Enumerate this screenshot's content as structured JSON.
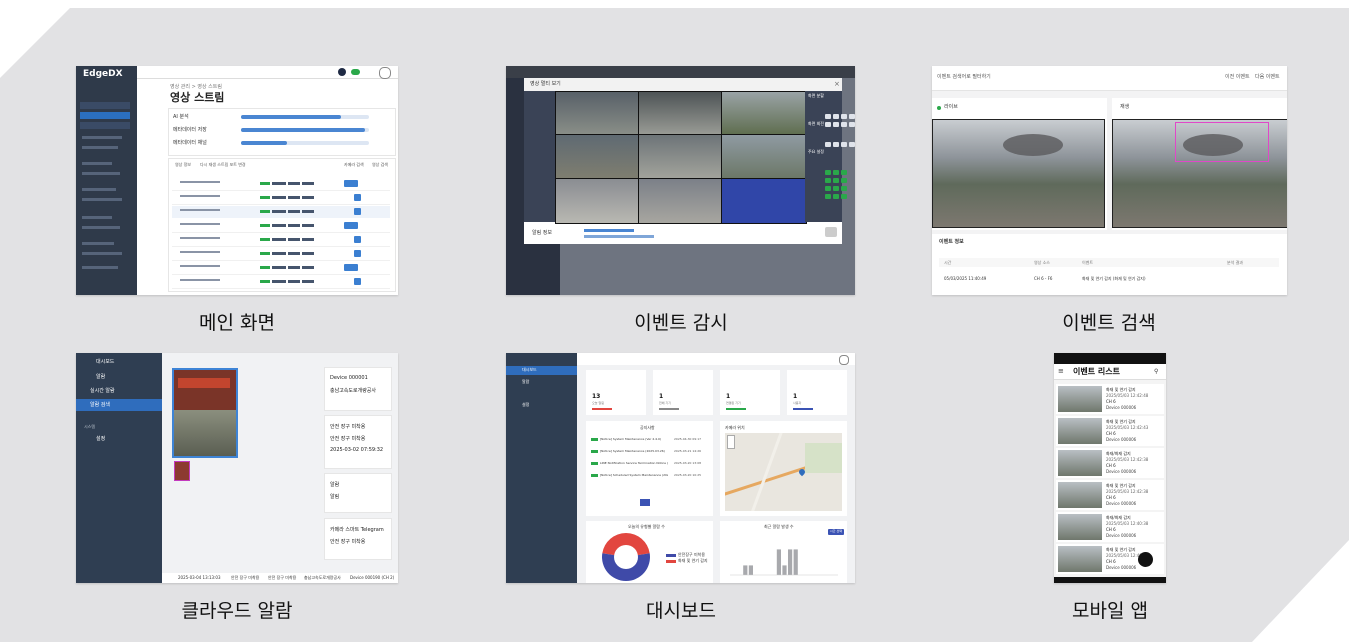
{
  "captions": [
    "메인 화면",
    "이벤트 감시",
    "이벤트 검색",
    "클라우드 알람",
    "대시보드",
    "모바일 앱"
  ],
  "main": {
    "logo": "EdgeDX",
    "title": "영상 스트림",
    "breadcrumb": "영상 관리 > 영상 스트림",
    "stats": [
      "AI 분석",
      "메타데이터 저장",
      "메타데이터 채널"
    ],
    "buttons": [
      "영상 정보",
      "다시 재생 스트림 포트 변경",
      "카메라 검색",
      "영상 검색"
    ]
  },
  "monitor": {
    "dialog_title": "영상 멀티 보기",
    "side_labels": [
      "화면 분할",
      "화면 회전",
      "주요 설정"
    ],
    "footer_label": "알림 정보",
    "close": "×"
  },
  "search": {
    "search_placeholder": "이벤트 검색어로 필터하기",
    "prev_event": "이전 이벤트",
    "next_event": "다음 이벤트",
    "left_label": "라이브",
    "right_label": "재생",
    "info_title": "이벤트 정보",
    "table_headers": [
      "시간",
      "영상 소스",
      "이벤트",
      "분석 결과"
    ],
    "table_row": [
      "05/03/2025 11:40:49",
      "CH 6 - F6",
      "화재 및 연기 감지 (화재 및 연기 감지)",
      ""
    ]
  },
  "cloud": {
    "menu": [
      "대시보드",
      "알람",
      "실시간 알람",
      "알람 검색",
      "시스템",
      "설정"
    ],
    "cards": [
      [
        "Device 000001",
        "충남고속도로개량공사"
      ],
      [
        "안전 장구 미착용",
        "안전 장구 미착용",
        "2025-03-02 07:59:32"
      ],
      [
        "알람",
        "알림"
      ],
      [
        "카메라 스마트 Telegram",
        "안전 장구 미착용"
      ]
    ],
    "footer": [
      "2025-03-04 13:13:03",
      "안전 장구 미착용",
      "안전 장구 미착용",
      "충남고속도로개량공사",
      "Device 000190 (CH 2)"
    ]
  },
  "dashboard": {
    "menu": [
      "대시보드",
      "알람",
      "설정"
    ],
    "kpis": [
      {
        "value": "13",
        "label": "오늘 알림"
      },
      {
        "value": "1",
        "label": "전체 기기"
      },
      {
        "value": "1",
        "label": "연결된 기기"
      },
      {
        "value": "1",
        "label": "사용자"
      }
    ],
    "notice_title": "공지사항",
    "notices": [
      [
        "[Notice] System Maintenance (Ver 2.4.0)",
        "2025-04-30 09:17"
      ],
      [
        "[Notice] System Maintenance (2025.03.26)",
        "2025-03-21 14:26"
      ],
      [
        "LINE Notification Service Termination Notice (2025.03.31)",
        "2025-03-20 13:08"
      ],
      [
        "[Notice] Scheduled System Maintenance (2025.03.22)",
        "2025-03-20 10:25"
      ]
    ],
    "map_title": "카메라 위치",
    "pie_title": "오늘의 유형별 알람 수",
    "pie_legend": [
      "안전장구 미착용",
      "화재 및 연기 감지"
    ],
    "bar_title": "최근 알람 발생 수",
    "bar_button": "시간 선택",
    "colors": {
      "pie_blue": "#3f4aa8",
      "pie_red": "#e2463f",
      "bars": "#a8a9ad"
    }
  },
  "mobile": {
    "title": "이벤트 리스트",
    "items": [
      {
        "title": "화재 및 연기 감지",
        "time": "2025/05/03 12:42:48",
        "ch": "CH 6",
        "device": "Device 000006"
      },
      {
        "title": "화재 및 연기 감지",
        "time": "2025/05/03 12:42:43",
        "ch": "CH 6",
        "device": "Device 000006"
      },
      {
        "title": "화재/화재 감지",
        "time": "2025/05/03 12:42:38",
        "ch": "CH 6",
        "device": "Device 000006"
      },
      {
        "title": "화재 및 연기 감지",
        "time": "2025/05/03 12:42:38",
        "ch": "CH 6",
        "device": "Device 000006"
      },
      {
        "title": "화재/화재 감지",
        "time": "2025/05/03 12:40:38",
        "ch": "CH 6",
        "device": "Device 000006"
      },
      {
        "title": "화재 및 연기 감지",
        "time": "2025/05/03 12:40:38",
        "ch": "CH 6",
        "device": "Device 000006"
      }
    ]
  }
}
